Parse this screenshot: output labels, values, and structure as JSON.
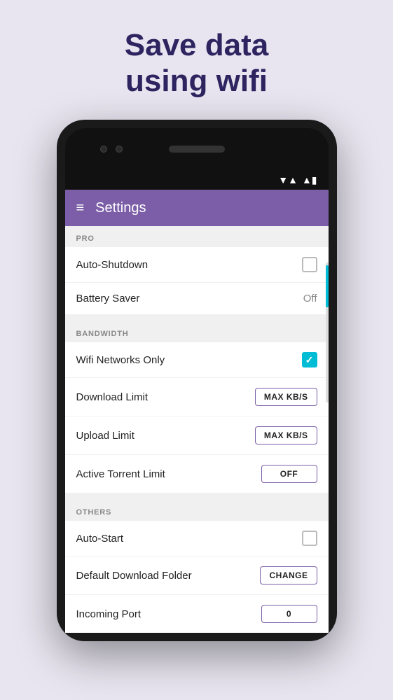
{
  "hero": {
    "line1": "Save data",
    "line2": "using wifi"
  },
  "toolbar": {
    "title": "Settings",
    "hamburger": "≡"
  },
  "status_bar": {
    "wifi": "▼",
    "signal": "▲",
    "battery": "▮"
  },
  "sections": [
    {
      "id": "pro",
      "header": "PRO",
      "rows": [
        {
          "id": "auto-shutdown",
          "label": "Auto-Shutdown",
          "control": "checkbox-unchecked"
        },
        {
          "id": "battery-saver",
          "label": "Battery Saver",
          "control": "value",
          "value": "Off"
        }
      ]
    },
    {
      "id": "bandwidth",
      "header": "BANDWIDTH",
      "rows": [
        {
          "id": "wifi-networks-only",
          "label": "Wifi Networks Only",
          "control": "checkbox-checked"
        },
        {
          "id": "download-limit",
          "label": "Download Limit",
          "control": "button",
          "button_label": "MAX KB/S"
        },
        {
          "id": "upload-limit",
          "label": "Upload Limit",
          "control": "button",
          "button_label": "MAX KB/S"
        },
        {
          "id": "active-torrent-limit",
          "label": "Active Torrent Limit",
          "control": "button",
          "button_label": "OFF"
        }
      ]
    },
    {
      "id": "others",
      "header": "OTHERS",
      "rows": [
        {
          "id": "auto-start",
          "label": "Auto-Start",
          "control": "checkbox-unchecked"
        },
        {
          "id": "default-download-folder",
          "label": "Default Download Folder",
          "control": "button",
          "button_label": "CHANGE"
        },
        {
          "id": "incoming-port",
          "label": "Incoming Port",
          "control": "button",
          "button_label": "0"
        }
      ]
    }
  ]
}
